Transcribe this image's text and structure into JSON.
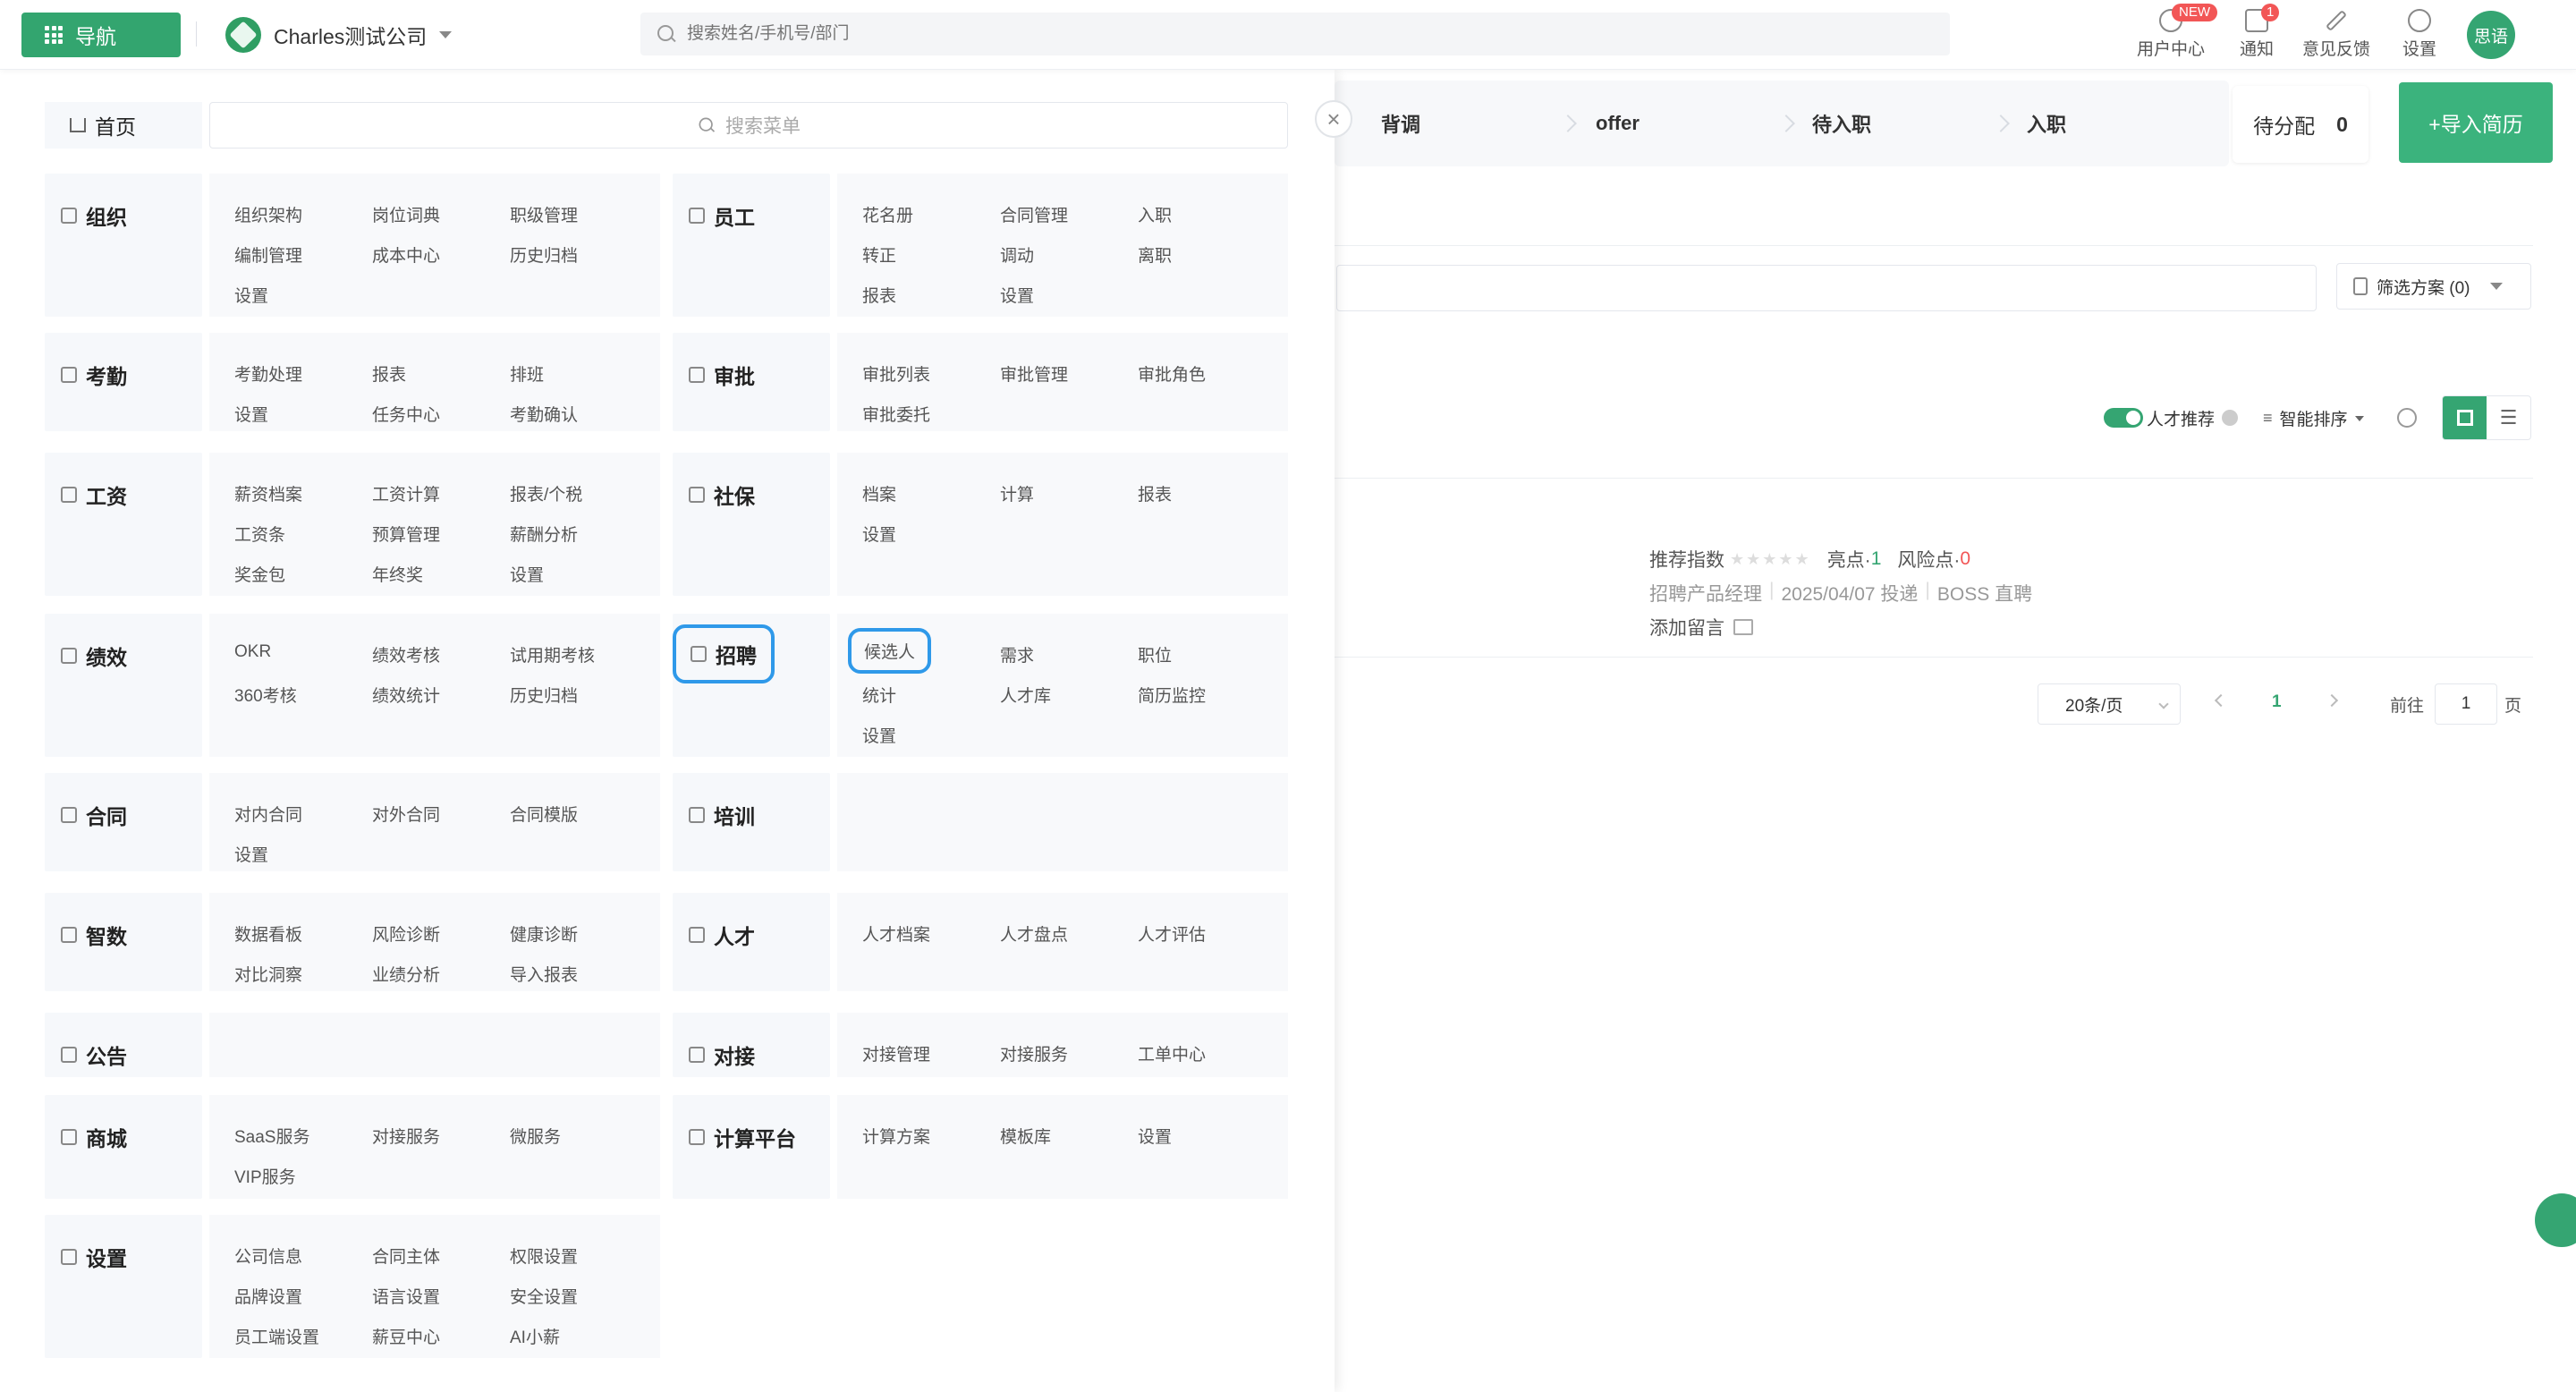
{
  "topbar": {
    "nav_label": "导航",
    "company_name": "Charles测试公司",
    "search_placeholder": "搜索姓名/手机号/部门",
    "tools": [
      {
        "label": "用户中心",
        "badge": "NEW"
      },
      {
        "label": "通知",
        "badge": "1"
      },
      {
        "label": "意见反馈",
        "badge": ""
      },
      {
        "label": "设置",
        "badge": ""
      }
    ],
    "avatar_text": "思语"
  },
  "menu": {
    "home_label": "首页",
    "search_placeholder": "搜索菜单",
    "categories": [
      {
        "name": "组织",
        "items": [
          "组织架构",
          "岗位词典",
          "职级管理",
          "编制管理",
          "成本中心",
          "历史归档",
          "设置"
        ]
      },
      {
        "name": "员工",
        "items": [
          "花名册",
          "合同管理",
          "入职",
          "转正",
          "调动",
          "离职",
          "报表",
          "设置"
        ]
      },
      {
        "name": "考勤",
        "items": [
          "考勤处理",
          "报表",
          "排班",
          "设置",
          "任务中心",
          "考勤确认"
        ]
      },
      {
        "name": "审批",
        "items": [
          "审批列表",
          "审批管理",
          "审批角色",
          "审批委托"
        ]
      },
      {
        "name": "工资",
        "items": [
          "薪资档案",
          "工资计算",
          "报表/个税",
          "工资条",
          "预算管理",
          "薪酬分析",
          "奖金包",
          "年终奖",
          "设置"
        ]
      },
      {
        "name": "社保",
        "items": [
          "档案",
          "计算",
          "报表",
          "设置"
        ]
      },
      {
        "name": "绩效",
        "items": [
          "OKR",
          "绩效考核",
          "试用期考核",
          "360考核",
          "绩效统计",
          "历史归档"
        ]
      },
      {
        "name": "招聘",
        "items": [
          "候选人",
          "需求",
          "职位",
          "统计",
          "人才库",
          "简历监控",
          "设置"
        ]
      },
      {
        "name": "合同",
        "items": [
          "对内合同",
          "对外合同",
          "合同模版",
          "设置"
        ]
      },
      {
        "name": "培训",
        "items": []
      },
      {
        "name": "智数",
        "items": [
          "数据看板",
          "风险诊断",
          "健康诊断",
          "对比洞察",
          "业绩分析",
          "导入报表"
        ]
      },
      {
        "name": "人才",
        "items": [
          "人才档案",
          "人才盘点",
          "人才评估"
        ]
      },
      {
        "name": "公告",
        "items": []
      },
      {
        "name": "对接",
        "items": [
          "对接管理",
          "对接服务",
          "工单中心"
        ]
      },
      {
        "name": "商城",
        "items": [
          "SaaS服务",
          "对接服务",
          "微服务",
          "VIP服务"
        ]
      },
      {
        "name": "计算平台",
        "items": [
          "计算方案",
          "模板库",
          "设置"
        ]
      },
      {
        "name": "设置",
        "items": [
          "公司信息",
          "合同主体",
          "权限设置",
          "品牌设置",
          "语言设置",
          "安全设置",
          "员工端设置",
          "薪豆中心",
          "AI小薪"
        ]
      }
    ]
  },
  "background": {
    "stages": [
      "背调",
      "offer",
      "待入职",
      "入职"
    ],
    "pending_label": "待分配",
    "pending_count": "0",
    "import_label": "+导入简历",
    "filter_plan_label": "筛选方案 (0)",
    "talent_recommend_label": "人才推荐",
    "sort_label": "智能排序",
    "candidate": {
      "recommend_label": "推荐指数",
      "highlight_label": "亮点·",
      "highlight_count": "1",
      "risk_label": "风险点·",
      "risk_count": "0",
      "position": "招聘产品经理",
      "date": "2025/04/07 投递",
      "source": "BOSS 直聘",
      "add_note": "添加留言"
    },
    "pagination": {
      "page_size": "20条/页",
      "current_page": "1",
      "goto_label": "前往",
      "goto_value": "1",
      "page_suffix": "页"
    }
  },
  "colors": {
    "brand": "#33a56f",
    "highlight_outline": "#2f99e9",
    "risk": "#f25656"
  }
}
